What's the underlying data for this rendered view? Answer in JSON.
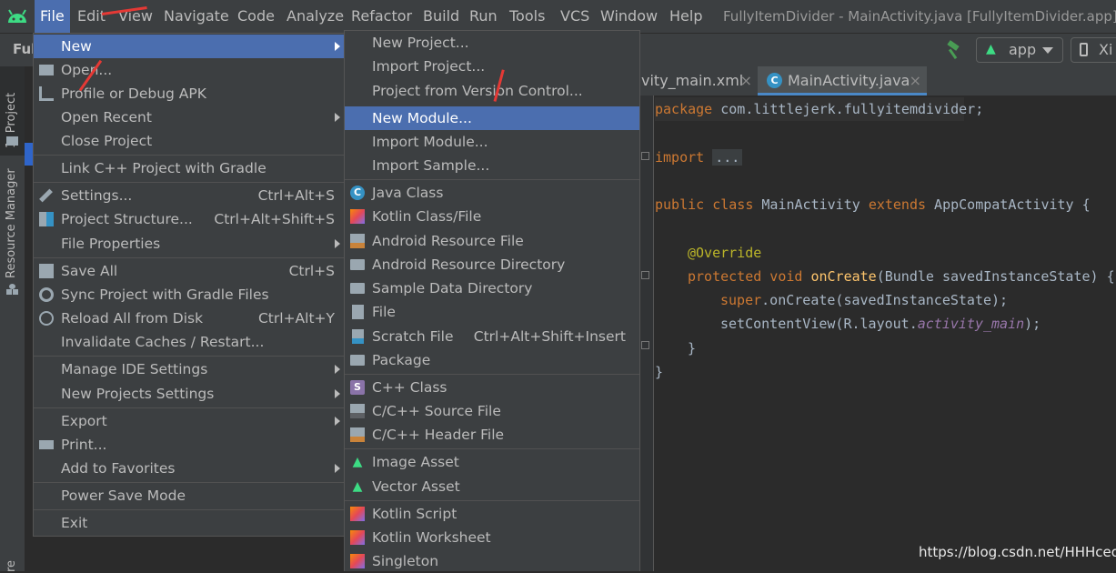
{
  "menubar": {
    "items": [
      "File",
      "Edit",
      "View",
      "Navigate",
      "Code",
      "Analyze",
      "Refactor",
      "Build",
      "Run",
      "Tools",
      "VCS",
      "Window",
      "Help"
    ],
    "title": "FullyItemDivider - MainActivity.java [FullyItemDivider.app]"
  },
  "toolbar": {
    "project_crumb": "Full",
    "run_config": "app",
    "device": "Xi"
  },
  "tool_strip": {
    "project_tab": "1: Project",
    "resource_manager": "Resource Manager",
    "bottom_fragment": "re"
  },
  "editor": {
    "tabs": [
      "vity_main.xml",
      "MainActivity.java"
    ],
    "code": {
      "l1_kw": "package",
      "l1_rest": " com.littlejerk.fullyitemdivider;",
      "l2_kw": "import",
      "l2_fold": "...",
      "l3_kw1": "public class",
      "l3_name": " MainActivity ",
      "l3_kw2": "extends",
      "l3_rest": " AppCompatActivity {",
      "l4_ann": "@Override",
      "l5_kw": "protected void",
      "l5_fn": " onCreate",
      "l5_rest": "(Bundle savedInstanceState) {",
      "l6_kw": "super",
      "l6_rest": ".onCreate(savedInstanceState);",
      "l7_pre": "setContentView(R.layout.",
      "l7_field": "activity_main",
      "l7_post": ");",
      "l8": "}",
      "l9": "}"
    }
  },
  "file_menu": {
    "items": [
      {
        "label": "New",
        "shortcut": "",
        "submenu": true,
        "selected": true,
        "icon": ""
      },
      {
        "label": "Open...",
        "shortcut": "",
        "icon": "folder-open-icon"
      },
      {
        "label": "Profile or Debug APK",
        "shortcut": "",
        "icon": "profile-icon"
      },
      {
        "label": "Open Recent",
        "shortcut": "",
        "submenu": true
      },
      {
        "label": "Close Project",
        "shortcut": ""
      },
      {
        "label": "Link C++ Project with Gradle",
        "shortcut": ""
      },
      {
        "label": "Settings...",
        "shortcut": "Ctrl+Alt+S",
        "icon": "wrench-icon"
      },
      {
        "label": "Project Structure...",
        "shortcut": "Ctrl+Alt+Shift+S",
        "icon": "project-structure-icon"
      },
      {
        "label": "File Properties",
        "shortcut": "",
        "submenu": true
      },
      {
        "label": "Save All",
        "shortcut": "Ctrl+S",
        "icon": "save-icon"
      },
      {
        "label": "Sync Project with Gradle Files",
        "shortcut": "",
        "icon": "gradle-sync-icon"
      },
      {
        "label": "Reload All from Disk",
        "shortcut": "Ctrl+Alt+Y",
        "icon": "reload-icon"
      },
      {
        "label": "Invalidate Caches / Restart...",
        "shortcut": ""
      },
      {
        "label": "Manage IDE Settings",
        "shortcut": "",
        "submenu": true
      },
      {
        "label": "New Projects Settings",
        "shortcut": "",
        "submenu": true
      },
      {
        "label": "Export",
        "shortcut": "",
        "submenu": true
      },
      {
        "label": "Print...",
        "shortcut": "",
        "icon": "print-icon"
      },
      {
        "label": "Add to Favorites",
        "shortcut": "",
        "submenu": true
      },
      {
        "label": "Power Save Mode",
        "shortcut": ""
      },
      {
        "label": "Exit",
        "shortcut": ""
      }
    ]
  },
  "new_submenu": {
    "items": [
      {
        "label": "New Project..."
      },
      {
        "label": "Import Project..."
      },
      {
        "label": "Project from Version Control..."
      },
      {
        "label": "New Module...",
        "selected": true
      },
      {
        "label": "Import Module..."
      },
      {
        "label": "Import Sample..."
      },
      {
        "label": "Java Class",
        "icon": "java-class-icon"
      },
      {
        "label": "Kotlin Class/File",
        "icon": "kotlin-icon"
      },
      {
        "label": "Android Resource File",
        "icon": "resource-file-icon"
      },
      {
        "label": "Android Resource Directory",
        "icon": "folder-icon"
      },
      {
        "label": "Sample Data Directory",
        "icon": "folder-icon"
      },
      {
        "label": "File",
        "icon": "file-icon"
      },
      {
        "label": "Scratch File",
        "shortcut": "Ctrl+Alt+Shift+Insert",
        "icon": "scratch-file-icon"
      },
      {
        "label": "Package",
        "icon": "package-icon"
      },
      {
        "label": "C++ Class",
        "icon": "cpp-class-icon"
      },
      {
        "label": "C/C++ Source File",
        "icon": "cpp-source-icon"
      },
      {
        "label": "C/C++ Header File",
        "icon": "cpp-header-icon"
      },
      {
        "label": "Image Asset",
        "icon": "android-icon"
      },
      {
        "label": "Vector Asset",
        "icon": "android-icon"
      },
      {
        "label": "Kotlin Script",
        "icon": "kotlin-icon"
      },
      {
        "label": "Kotlin Worksheet",
        "icon": "kotlin-icon"
      },
      {
        "label": "Singleton",
        "icon": "kotlin-icon"
      }
    ]
  },
  "watermark": "https://blog.csdn.net/HHHceo",
  "colors": {
    "selection": "#4b6eaf",
    "menu_bg": "#3c3f41",
    "editor_bg": "#2b2b2b",
    "keyword": "#cc7832",
    "annotation": "#bbb529",
    "function": "#ffc66d",
    "field": "#9876aa"
  }
}
